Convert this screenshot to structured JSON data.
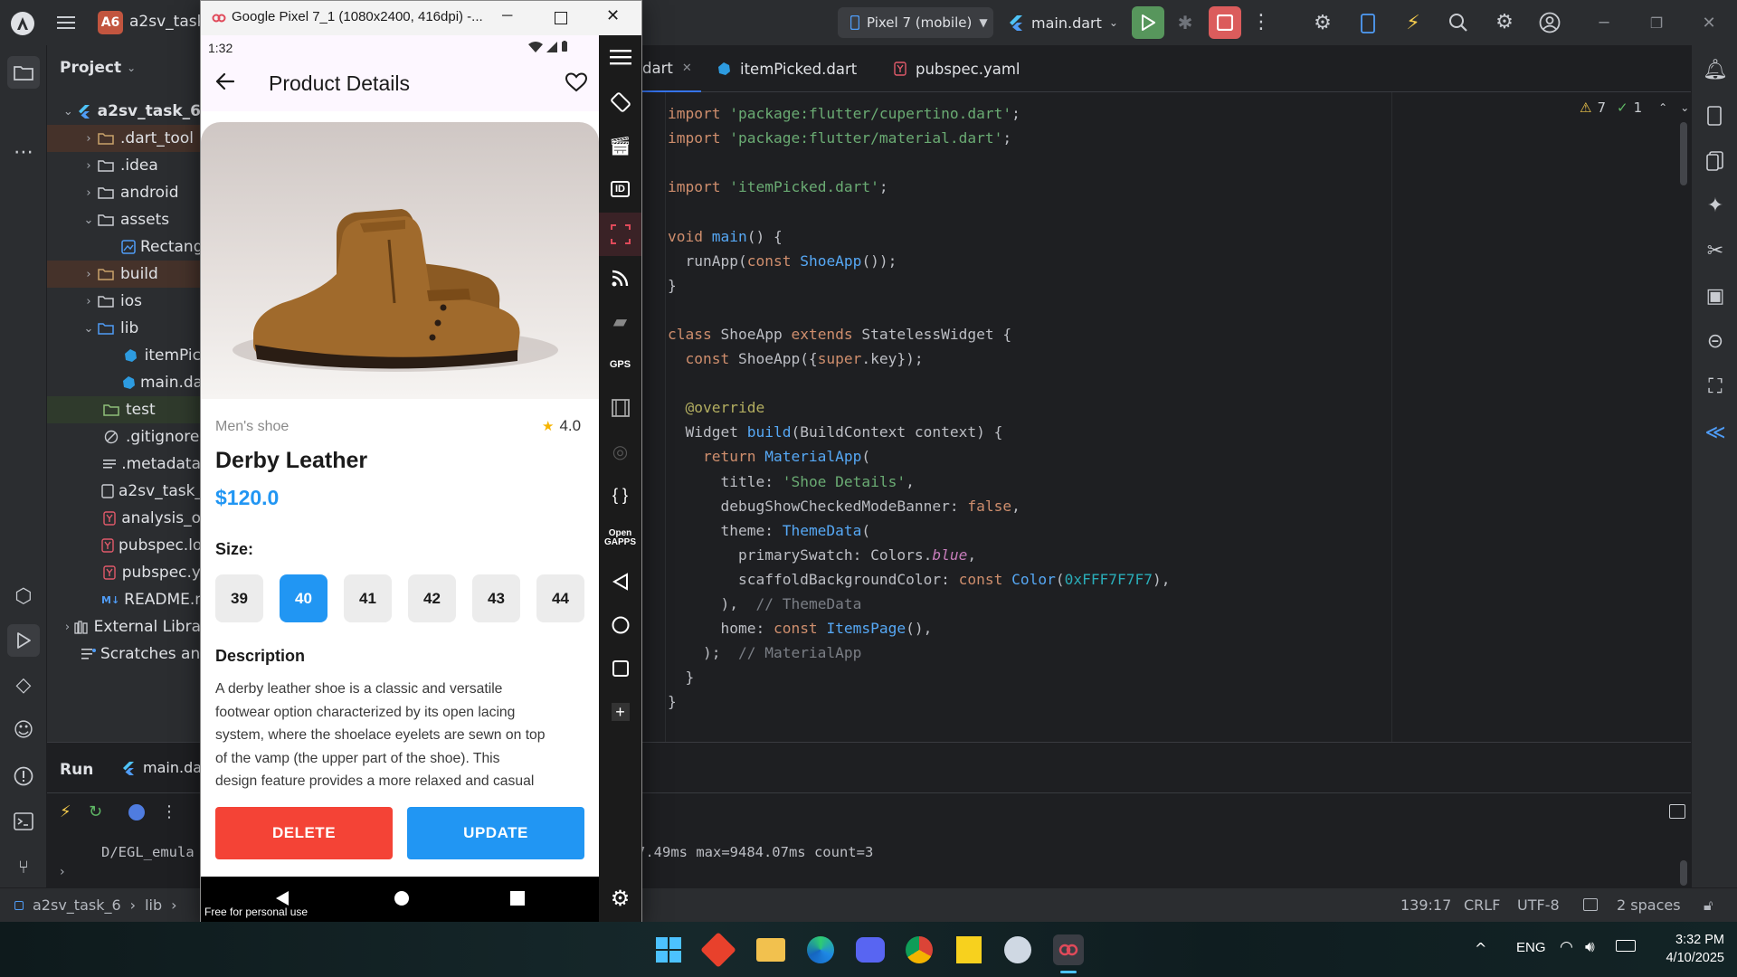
{
  "ide": {
    "project_badge": "A6",
    "project_name": "a2sv_task",
    "device": "Pixel 7 (mobile)",
    "run_config": "main.dart",
    "project_panel_title": "Project",
    "tabs": [
      {
        "label": "dart"
      },
      {
        "label": "itemPicked.dart"
      },
      {
        "label": "pubspec.yaml"
      }
    ],
    "inspections": {
      "warnings": "7",
      "checks": "1"
    },
    "tree": [
      {
        "label": "a2sv_task_6",
        "chev": "⌄"
      },
      {
        "label": ".dart_tool",
        "chev": "›"
      },
      {
        "label": ".idea",
        "chev": "›"
      },
      {
        "label": "android",
        "chev": "›"
      },
      {
        "label": "assets",
        "chev": "⌄"
      },
      {
        "label": "Rectang"
      },
      {
        "label": "build",
        "chev": "›"
      },
      {
        "label": "ios",
        "chev": "›"
      },
      {
        "label": "lib",
        "chev": "⌄"
      },
      {
        "label": "itemPic"
      },
      {
        "label": "main.da"
      },
      {
        "label": "test"
      },
      {
        "label": ".gitignore"
      },
      {
        "label": ".metadata"
      },
      {
        "label": "a2sv_task_"
      },
      {
        "label": "analysis_o"
      },
      {
        "label": "pubspec.lo"
      },
      {
        "label": "pubspec.y"
      },
      {
        "label": "README.m"
      },
      {
        "label": "External Libra",
        "chev": "›"
      },
      {
        "label": "Scratches and"
      }
    ],
    "run": {
      "title": "Run",
      "tab": "main.da",
      "log_left": "D/EGL_emula",
      "log_right": "7.49ms max=9484.07ms count=3"
    },
    "status": {
      "breadcrumb": [
        "a2sv_task_6",
        "lib"
      ],
      "position": "139:17",
      "line_sep": "CRLF",
      "encoding": "UTF-8",
      "indent": "2 spaces"
    }
  },
  "code": [
    [
      {
        "t": "import ",
        "c": "kw"
      },
      {
        "t": "'package:flutter/cupertino.dart'",
        "c": "str"
      },
      {
        "t": ";"
      }
    ],
    [
      {
        "t": "import ",
        "c": "kw"
      },
      {
        "t": "'package:flutter/material.dart'",
        "c": "str"
      },
      {
        "t": ";"
      }
    ],
    [],
    [
      {
        "t": "import ",
        "c": "kw"
      },
      {
        "t": "'itemPicked.dart'",
        "c": "str"
      },
      {
        "t": ";"
      }
    ],
    [],
    [
      {
        "t": "void ",
        "c": "kw"
      },
      {
        "t": "main",
        "c": "fn"
      },
      {
        "t": "() {"
      }
    ],
    [
      {
        "t": "  runApp("
      },
      {
        "t": "const ",
        "c": "kw"
      },
      {
        "t": "ShoeApp",
        "c": "cls"
      },
      {
        "t": "());"
      }
    ],
    [
      {
        "t": "}"
      }
    ],
    [],
    [
      {
        "t": "class ",
        "c": "kw"
      },
      {
        "t": "ShoeApp "
      },
      {
        "t": "extends ",
        "c": "kw"
      },
      {
        "t": "StatelessWidget {"
      }
    ],
    [
      {
        "t": "  const ",
        "c": "kw"
      },
      {
        "t": "ShoeApp({"
      },
      {
        "t": "super",
        "c": "kw"
      },
      {
        "t": ".key});"
      }
    ],
    [],
    [
      {
        "t": "  @override",
        "c": "ann"
      }
    ],
    [
      {
        "t": "  Widget "
      },
      {
        "t": "build",
        "c": "fn"
      },
      {
        "t": "(BuildContext context) {"
      }
    ],
    [
      {
        "t": "    return ",
        "c": "kw"
      },
      {
        "t": "MaterialApp",
        "c": "cls"
      },
      {
        "t": "("
      }
    ],
    [
      {
        "t": "      title: "
      },
      {
        "t": "'Shoe Details'",
        "c": "str"
      },
      {
        "t": ","
      }
    ],
    [
      {
        "t": "      debugShowCheckedModeBanner: "
      },
      {
        "t": "false",
        "c": "kw"
      },
      {
        "t": ","
      }
    ],
    [
      {
        "t": "      theme: "
      },
      {
        "t": "ThemeData",
        "c": "cls"
      },
      {
        "t": "("
      }
    ],
    [
      {
        "t": "        primarySwatch: Colors."
      },
      {
        "t": "blue",
        "c": "ital"
      },
      {
        "t": ","
      }
    ],
    [
      {
        "t": "        scaffoldBackgroundColor: "
      },
      {
        "t": "const ",
        "c": "kw"
      },
      {
        "t": "Color",
        "c": "cls"
      },
      {
        "t": "("
      },
      {
        "t": "0xFFF7F7F7",
        "c": "num"
      },
      {
        "t": "),"
      }
    ],
    [
      {
        "t": "      ),  "
      },
      {
        "t": "// ThemeData",
        "c": "cmt"
      }
    ],
    [
      {
        "t": "      home: "
      },
      {
        "t": "const ",
        "c": "kw"
      },
      {
        "t": "ItemsPage",
        "c": "cls"
      },
      {
        "t": "(),"
      }
    ],
    [
      {
        "t": "    );  "
      },
      {
        "t": "// MaterialApp",
        "c": "cmt"
      }
    ],
    [
      {
        "t": "  }"
      }
    ],
    [
      {
        "t": "}"
      }
    ]
  ],
  "emulator": {
    "title": "Google Pixel 7_1 (1080x2400, 416dpi) -...",
    "time": "1:32",
    "watermark": "Free for personal use"
  },
  "app": {
    "title": "Product Details",
    "category": "Men's shoe",
    "rating": "4.0",
    "name": "Derby Leather",
    "price": "$120.0",
    "size_label": "Size:",
    "sizes": [
      "39",
      "40",
      "41",
      "42",
      "43",
      "44"
    ],
    "selected_size": "40",
    "description_label": "Description",
    "description_lines": [
      "A derby leather shoe is a classic and versatile",
      "footwear option characterized by its open lacing",
      "system, where the shoelace eyelets are sewn on top",
      "of the vamp (the upper part of the shoe). This",
      "design feature provides a more relaxed and casual"
    ],
    "delete_label": "DELETE",
    "update_label": "UPDATE",
    "colors": {
      "primary": "#2196f3",
      "danger": "#f44336",
      "star": "#f6b400"
    }
  },
  "taskbar": {
    "lang": "ENG",
    "time": "3:32 PM",
    "date": "4/10/2025"
  }
}
